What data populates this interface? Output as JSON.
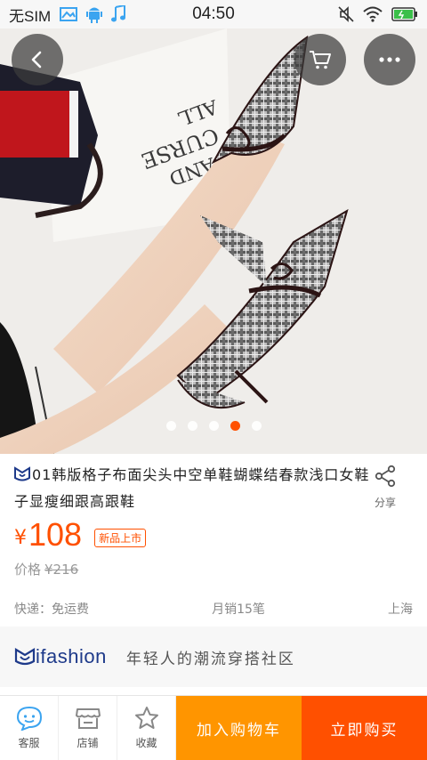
{
  "status_bar": {
    "carrier": "无SIM",
    "time": "04:50"
  },
  "gallery": {
    "slide_count": 5,
    "active_index": 3
  },
  "product": {
    "title": "01韩版格子布面尖头中空单鞋蝴蝶结春款浅口女鞋子显瘦细跟高跟鞋",
    "currency": "¥",
    "price": "108",
    "tag": "新品上市",
    "original_price_label": "价格",
    "original_price": "¥216",
    "shipping": "快递：免运费",
    "monthly_sales": "月销15笔",
    "location": "上海"
  },
  "share": {
    "label": "分享"
  },
  "banner": {
    "brand": "ifashion",
    "slogan": "年轻人的潮流穿搭社区"
  },
  "bottom_bar": {
    "service": "客服",
    "shop": "店铺",
    "favorite": "收藏",
    "add_to_cart": "加入购物车",
    "buy_now": "立即购买"
  },
  "colors": {
    "accent": "#ff5000",
    "cart": "#ff9500",
    "brand": "#1e3a8a"
  }
}
